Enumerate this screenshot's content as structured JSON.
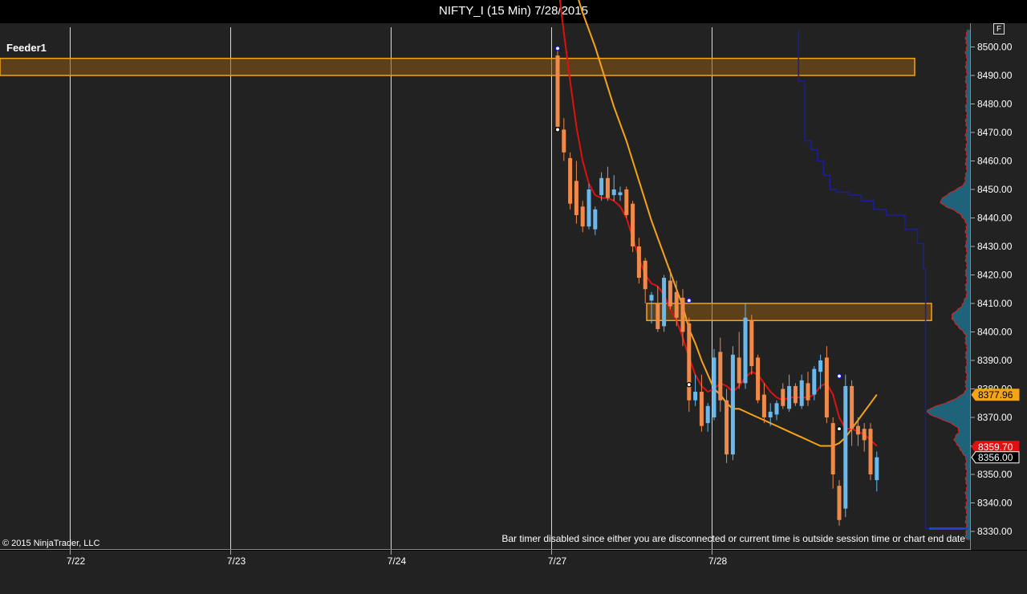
{
  "window": {
    "title": "NIFTY_I (15 Min)  7/28/2015"
  },
  "panel": {
    "label": "Feeder1",
    "button_label": "F"
  },
  "footer": {
    "copyright": "© 2015 NinjaTrader, LLC",
    "bar_timer_msg": "Bar timer disabled since either you are disconnected or current time is outside session time or chart end date"
  },
  "colors": {
    "background": "#222222",
    "up_candle": "#6ab8ec",
    "down_candle": "#f08a4b",
    "fast_ma": "#e01010",
    "slow_ma": "#f5a318",
    "blue_line": "#1c1c9c",
    "zone_fill": "#8a5a14",
    "zone_border": "#f5a318",
    "volume_profile": "#1f6f8b",
    "grid": "#d8d8d8"
  },
  "chart_data": {
    "type": "candlestick",
    "ylim": [
      8327,
      8506
    ],
    "yticks": [
      "8500.00",
      "8490.00",
      "8480.00",
      "8470.00",
      "8460.00",
      "8450.00",
      "8440.00",
      "8430.00",
      "8420.00",
      "8410.00",
      "8400.00",
      "8390.00",
      "8380.00",
      "8370.00",
      "8360.00",
      "8350.00",
      "8340.00",
      "8330.00"
    ],
    "date_labels": [
      "7/22",
      "7/23",
      "7/24",
      "7/27",
      "7/28"
    ],
    "price_labels": [
      {
        "text": "8377.96",
        "value": 8377.96,
        "style": "orange"
      },
      {
        "text": "8359.70",
        "value": 8359.7,
        "style": "red"
      },
      {
        "text": "8356.00",
        "value": 8356.0,
        "style": "black"
      }
    ],
    "zones": [
      {
        "low": 8490,
        "high": 8496
      },
      {
        "low": 8404,
        "high": 8410
      }
    ],
    "candles": [
      {
        "o": 8497,
        "h": 8500,
        "l": 8470,
        "c": 8472
      },
      {
        "o": 8471,
        "h": 8475,
        "l": 8460,
        "c": 8463
      },
      {
        "o": 8461,
        "h": 8463,
        "l": 8443,
        "c": 8445
      },
      {
        "o": 8453,
        "h": 8460,
        "l": 8438,
        "c": 8441
      },
      {
        "o": 8444,
        "h": 8446,
        "l": 8435,
        "c": 8437
      },
      {
        "o": 8437,
        "h": 8452,
        "l": 8436,
        "c": 8450
      },
      {
        "o": 8436,
        "h": 8444,
        "l": 8434,
        "c": 8443
      },
      {
        "o": 8448,
        "h": 8456,
        "l": 8446,
        "c": 8454
      },
      {
        "o": 8454,
        "h": 8458,
        "l": 8446,
        "c": 8447
      },
      {
        "o": 8448,
        "h": 8455,
        "l": 8446,
        "c": 8450
      },
      {
        "o": 8448,
        "h": 8451,
        "l": 8446,
        "c": 8449
      },
      {
        "o": 8450,
        "h": 8451,
        "l": 8440,
        "c": 8441
      },
      {
        "o": 8445,
        "h": 8446,
        "l": 8428,
        "c": 8430
      },
      {
        "o": 8430,
        "h": 8433,
        "l": 8417,
        "c": 8419
      },
      {
        "o": 8425,
        "h": 8426,
        "l": 8410,
        "c": 8415
      },
      {
        "o": 8411,
        "h": 8414,
        "l": 8403,
        "c": 8413
      },
      {
        "o": 8410,
        "h": 8416,
        "l": 8400,
        "c": 8401
      },
      {
        "o": 8402,
        "h": 8420,
        "l": 8400,
        "c": 8419
      },
      {
        "o": 8418,
        "h": 8422,
        "l": 8408,
        "c": 8409
      },
      {
        "o": 8414,
        "h": 8418,
        "l": 8402,
        "c": 8405
      },
      {
        "o": 8412,
        "h": 8415,
        "l": 8395,
        "c": 8400
      },
      {
        "o": 8403,
        "h": 8405,
        "l": 8372,
        "c": 8376
      },
      {
        "o": 8376,
        "h": 8385,
        "l": 8374,
        "c": 8379
      },
      {
        "o": 8379,
        "h": 8385,
        "l": 8365,
        "c": 8367
      },
      {
        "o": 8368,
        "h": 8375,
        "l": 8365,
        "c": 8374
      },
      {
        "o": 8370,
        "h": 8394,
        "l": 8369,
        "c": 8391
      },
      {
        "o": 8393,
        "h": 8398,
        "l": 8372,
        "c": 8376
      },
      {
        "o": 8376,
        "h": 8380,
        "l": 8354,
        "c": 8357
      },
      {
        "o": 8357,
        "h": 8395,
        "l": 8355,
        "c": 8392
      },
      {
        "o": 8391,
        "h": 8400,
        "l": 8380,
        "c": 8382
      },
      {
        "o": 8382,
        "h": 8410,
        "l": 8380,
        "c": 8405
      },
      {
        "o": 8404,
        "h": 8406,
        "l": 8385,
        "c": 8388
      },
      {
        "o": 8391,
        "h": 8392,
        "l": 8375,
        "c": 8376
      },
      {
        "o": 8378,
        "h": 8382,
        "l": 8368,
        "c": 8370
      },
      {
        "o": 8370,
        "h": 8375,
        "l": 8367,
        "c": 8372
      },
      {
        "o": 8371,
        "h": 8376,
        "l": 8369,
        "c": 8375
      },
      {
        "o": 8380,
        "h": 8382,
        "l": 8373,
        "c": 8374
      },
      {
        "o": 8373,
        "h": 8385,
        "l": 8372,
        "c": 8381
      },
      {
        "o": 8381,
        "h": 8382,
        "l": 8374,
        "c": 8375
      },
      {
        "o": 8374,
        "h": 8385,
        "l": 8373,
        "c": 8383
      },
      {
        "o": 8382,
        "h": 8386,
        "l": 8374,
        "c": 8376
      },
      {
        "o": 8378,
        "h": 8388,
        "l": 8376,
        "c": 8387
      },
      {
        "o": 8386,
        "h": 8392,
        "l": 8380,
        "c": 8390
      },
      {
        "o": 8391,
        "h": 8395,
        "l": 8368,
        "c": 8370
      },
      {
        "o": 8368,
        "h": 8370,
        "l": 8345,
        "c": 8350
      },
      {
        "o": 8346,
        "h": 8348,
        "l": 8332,
        "c": 8334
      },
      {
        "o": 8338,
        "h": 8385,
        "l": 8335,
        "c": 8381
      },
      {
        "o": 8381,
        "h": 8383,
        "l": 8360,
        "c": 8366
      },
      {
        "o": 8367,
        "h": 8370,
        "l": 8360,
        "c": 8364
      },
      {
        "o": 8366,
        "h": 8368,
        "l": 8358,
        "c": 8362
      },
      {
        "o": 8366,
        "h": 8368,
        "l": 8348,
        "c": 8350
      },
      {
        "o": 8348,
        "h": 8358,
        "l": 8344,
        "c": 8356
      }
    ],
    "fast_ma": [
      8523,
      8505,
      8488,
      8472,
      8460,
      8452,
      8448,
      8447,
      8447,
      8446,
      8444,
      8440,
      8433,
      8426,
      8420,
      8417,
      8416,
      8413,
      8408,
      8404,
      8398,
      8391,
      8385,
      8381,
      8379,
      8380,
      8382,
      8381,
      8379,
      8381,
      8384,
      8386,
      8385,
      8382,
      8379,
      8377,
      8376,
      8377,
      8377,
      8377,
      8377,
      8378,
      8381,
      8382,
      8378,
      8370,
      8366,
      8366,
      8365,
      8364,
      8362,
      8360
    ],
    "slow_ma": [
      8541,
      8533,
      8526,
      8519,
      8512,
      8506,
      8500,
      8493,
      8486,
      8479,
      8473,
      8467,
      8460,
      8453,
      8446,
      8439,
      8433,
      8427,
      8421,
      8415,
      8409,
      8401,
      8396,
      8390,
      8385,
      8380,
      8378,
      8375,
      8373,
      8373,
      8372,
      8371,
      8370,
      8369,
      8368,
      8367,
      8366,
      8365,
      8364,
      8363,
      8362,
      8361,
      8360,
      8360,
      8360,
      8361,
      8363,
      8366,
      8369,
      8372,
      8375,
      8378
    ],
    "blue_line": [
      [
        38.5,
        8506
      ],
      [
        38.5,
        8488
      ],
      [
        39.5,
        8488
      ],
      [
        39.5,
        8467
      ],
      [
        40.5,
        8467
      ],
      [
        40.5,
        8464
      ],
      [
        41.5,
        8464
      ],
      [
        41.5,
        8460
      ],
      [
        42.5,
        8460
      ],
      [
        42.5,
        8455
      ],
      [
        43.5,
        8455
      ],
      [
        43.5,
        8450
      ],
      [
        44.5,
        8450
      ],
      [
        44.5,
        8449
      ],
      [
        46.5,
        8449
      ],
      [
        46.5,
        8448
      ],
      [
        48.5,
        8448
      ],
      [
        48.5,
        8446
      ],
      [
        50.5,
        8446
      ],
      [
        50.5,
        8443
      ],
      [
        52.5,
        8443
      ],
      [
        52.5,
        8441
      ],
      [
        55.5,
        8441
      ],
      [
        55.5,
        8436
      ],
      [
        57.5,
        8436
      ],
      [
        57.5,
        8431
      ],
      [
        58.5,
        8431
      ],
      [
        58.5,
        8422
      ],
      [
        58.8,
        8422
      ],
      [
        58.8,
        8331
      ],
      [
        61.5,
        8331
      ]
    ],
    "markers": [
      {
        "i": 0,
        "value": 8499.5,
        "color": "blue"
      },
      {
        "i": 0,
        "value": 8471,
        "color": "black"
      },
      {
        "i": 21,
        "value": 8411,
        "color": "blue"
      },
      {
        "i": 21,
        "value": 8381.5,
        "color": "black"
      },
      {
        "i": 45,
        "value": 8384.5,
        "color": "blue"
      },
      {
        "i": 45,
        "value": 8366,
        "color": "black"
      }
    ],
    "volume_profile_peaks": [
      {
        "value": 8446,
        "len": 32
      },
      {
        "value": 8372,
        "len": 48
      },
      {
        "value": 8405,
        "len": 18
      },
      {
        "value": 8362,
        "len": 14
      }
    ]
  }
}
